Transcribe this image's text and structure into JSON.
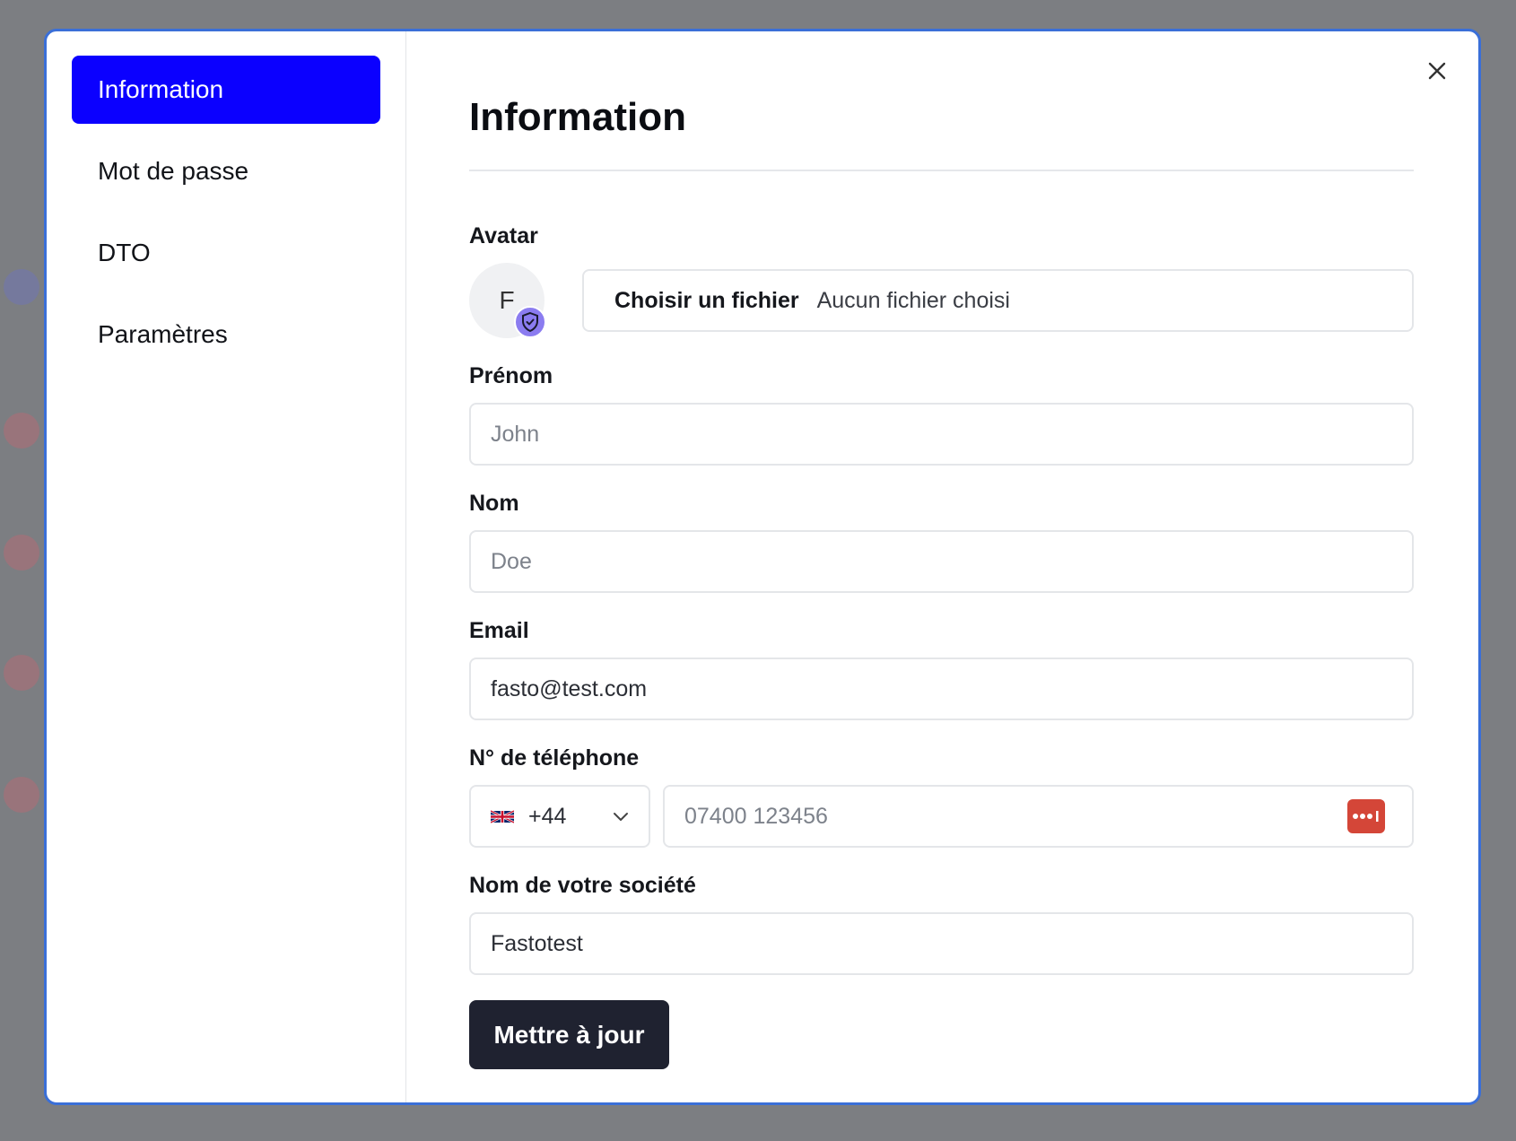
{
  "sidebar": {
    "items": [
      {
        "label": "Information",
        "active": true
      },
      {
        "label": "Mot de passe",
        "active": false
      },
      {
        "label": "DTO",
        "active": false
      },
      {
        "label": "Paramètres",
        "active": false
      }
    ]
  },
  "main": {
    "title": "Information",
    "avatar": {
      "label": "Avatar",
      "initial": "F",
      "file_button": "Choisir un fichier",
      "file_status": "Aucun fichier choisi"
    },
    "first_name": {
      "label": "Prénom",
      "placeholder": "John",
      "value": ""
    },
    "last_name": {
      "label": "Nom",
      "placeholder": "Doe",
      "value": ""
    },
    "email": {
      "label": "Email",
      "value": "fasto@test.com"
    },
    "phone": {
      "label": "N° de téléphone",
      "country_code": "+44",
      "country_flag": "uk-flag-icon",
      "placeholder": "07400 123456"
    },
    "company": {
      "label": "Nom de votre société",
      "value": "Fastotest"
    },
    "submit_label": "Mettre à jour"
  },
  "colors": {
    "accent": "#0b00ff",
    "modal_border": "#3a6fd8",
    "button_dark": "#1f2230",
    "badge": "#8b7cf0",
    "password_manager": "#d44638"
  }
}
